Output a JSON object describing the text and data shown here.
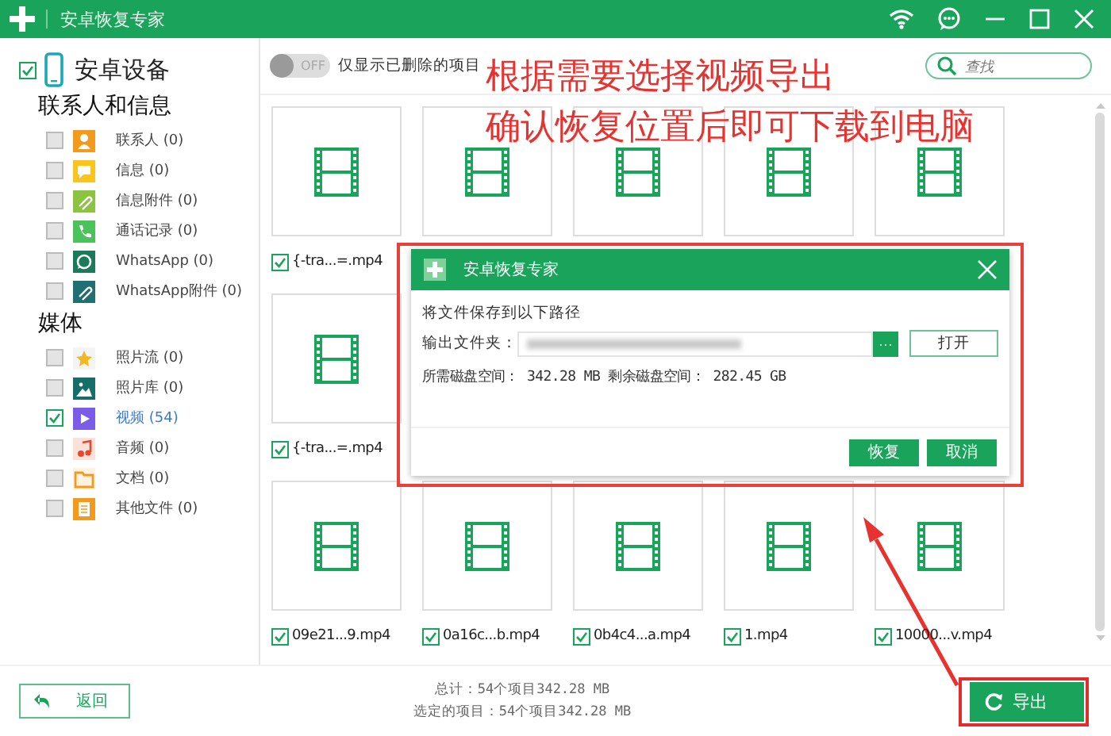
{
  "window": {
    "title": "安卓恢复专家"
  },
  "sidebar": {
    "device": {
      "label": "安卓设备",
      "checked": true
    },
    "groups": [
      {
        "title": "联系人和信息",
        "items": [
          {
            "label": "联系人 (0)",
            "kind": "contacts",
            "checked": false,
            "selected": false
          },
          {
            "label": "信息 (0)",
            "kind": "messages",
            "checked": false,
            "selected": false
          },
          {
            "label": "信息附件 (0)",
            "kind": "attachments",
            "checked": false,
            "selected": false
          },
          {
            "label": "通话记录 (0)",
            "kind": "calls",
            "checked": false,
            "selected": false
          },
          {
            "label": "WhatsApp (0)",
            "kind": "whatsapp",
            "checked": false,
            "selected": false
          },
          {
            "label": "WhatsApp附件 (0)",
            "kind": "whatsapp_attachments",
            "checked": false,
            "selected": false
          }
        ]
      },
      {
        "title": "媒体",
        "items": [
          {
            "label": "照片流 (0)",
            "kind": "photo_stream",
            "checked": false,
            "selected": false
          },
          {
            "label": "照片库 (0)",
            "kind": "photo_library",
            "checked": false,
            "selected": false
          },
          {
            "label": "视频 (54)",
            "kind": "video",
            "checked": true,
            "selected": true
          },
          {
            "label": "音频 (0)",
            "kind": "audio",
            "checked": false,
            "selected": false
          },
          {
            "label": "文档 (0)",
            "kind": "document",
            "checked": false,
            "selected": false
          },
          {
            "label": "其他文件 (0)",
            "kind": "other",
            "checked": false,
            "selected": false
          }
        ]
      }
    ]
  },
  "toolbar": {
    "toggle": {
      "label": "OFF",
      "on": false
    },
    "filter_label": "仅显示已删除的项目",
    "search": {
      "placeholder": "查找"
    }
  },
  "annotation": {
    "lines": [
      "根据需要选择视频导出",
      "确认恢复位置后即可下载到电脑"
    ]
  },
  "grid": {
    "rows": [
      [
        {
          "kind": "video",
          "name": "{-tra...=.mp4",
          "checked": true
        },
        {
          "kind": "video"
        },
        {
          "kind": "video"
        },
        {
          "kind": "video"
        },
        {
          "kind": "video"
        }
      ],
      [
        {
          "kind": "video",
          "name": "{-tra...=.mp4",
          "checked": true
        },
        {
          "kind": "hidden"
        },
        {
          "kind": "hidden"
        },
        {
          "kind": "hidden"
        },
        {
          "kind": "hidden"
        }
      ],
      [
        {
          "kind": "video",
          "name": "09e21...9.mp4",
          "checked": true
        },
        {
          "kind": "video",
          "name": "0a16c...b.mp4",
          "checked": true
        },
        {
          "kind": "video",
          "name": "0b4c4...a.mp4",
          "checked": true
        },
        {
          "kind": "video",
          "name": "1.mp4",
          "checked": true
        },
        {
          "kind": "video",
          "name": "10000...v.mp4",
          "checked": true
        }
      ]
    ]
  },
  "dialog": {
    "title": "安卓恢复专家",
    "message": "将文件保存到以下路径",
    "field_label": "输出文件夹：",
    "browse": "···",
    "open": "打开",
    "space_info": "所需磁盘空间： 342.28 MB 剩余磁盘空间： 282.45 GB",
    "buttons": [
      "恢复",
      "取消"
    ]
  },
  "footer": {
    "back": "返回",
    "total": "总计：54个项目342.28 MB",
    "selected": "选定的项目：54个项目342.28 MB",
    "export": "导出"
  }
}
